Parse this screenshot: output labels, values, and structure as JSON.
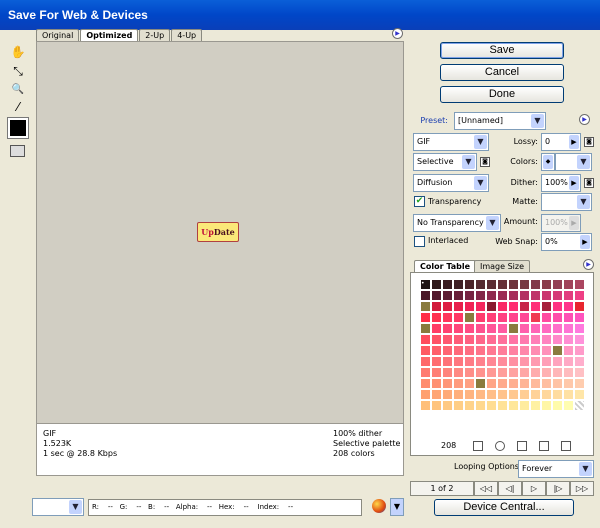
{
  "window": {
    "title": "Save For Web & Devices"
  },
  "tools": [
    {
      "name": "hand-tool-icon",
      "glyph": "✋"
    },
    {
      "name": "slice-select-tool-icon",
      "glyph": "⤡"
    },
    {
      "name": "zoom-tool-icon",
      "glyph": "🔍"
    },
    {
      "name": "eyedropper-tool-icon",
      "glyph": "⁄"
    }
  ],
  "tabs": [
    "Original",
    "Optimized",
    "2-Up",
    "4-Up"
  ],
  "preview": {
    "logo_text_up": "Up",
    "logo_text_date": "Date"
  },
  "info": {
    "format": "GIF",
    "size": "1.523K",
    "time": "1 sec @ 28.8 Kbps",
    "dither": "100% dither",
    "palette": "Selective palette",
    "colors": "208 colors"
  },
  "buttons": {
    "save": "Save",
    "cancel": "Cancel",
    "done": "Done",
    "device_central": "Device Central..."
  },
  "settings": {
    "preset_label": "Preset:",
    "preset_value": "[Unnamed]",
    "format": "GIF",
    "lossy_label": "Lossy:",
    "lossy_value": "0",
    "reduction": "Selective",
    "colors_label": "Colors:",
    "colors_value": "",
    "dither_algo": "Diffusion",
    "dither_label": "Dither:",
    "dither_value": "100%",
    "transparency_label": "Transparency",
    "matte_label": "Matte:",
    "trans_dither": "No Transparency ...",
    "amount_label": "Amount:",
    "amount_value": "100%",
    "interlaced_label": "Interlaced",
    "websnap_label": "Web Snap:",
    "websnap_value": "0%"
  },
  "color_table": {
    "tab_color": "Color Table",
    "tab_image_size": "Image Size",
    "count": "208",
    "swatches": [
      "#1d1313",
      "#2f181a",
      "#3a1c20",
      "#3f1f24",
      "#4a2227",
      "#552a30",
      "#5b2c33",
      "#652f37",
      "#6e323b",
      "#783843",
      "#82394a",
      "#8b3d4c",
      "#943f55",
      "#a0425a",
      "#ab4560",
      "#4b1727",
      "#53192d",
      "#5e1c33",
      "#6a1f39",
      "#772241",
      "#832547",
      "#8f284e",
      "#9b2b55",
      "#a72d5b",
      "#b33062",
      "#bf3369",
      "#cb3670",
      "#d63977",
      "#e23c7e",
      "#ee3f85",
      "#8a7b3e",
      "#d21a3b",
      "#de1d43",
      "#e8204c",
      "#f02355",
      "#f5265e",
      "#8b1a30",
      "#fa2a67",
      "#ff2d70",
      "#c82447",
      "#ff3079",
      "#a71f3b",
      "#ff3382",
      "#ff368b",
      "#e8262f",
      "#ff2e46",
      "#ff3150",
      "#ff355a",
      "#ff3864",
      "#8a7b3e",
      "#ff3c6e",
      "#ff3f78",
      "#ff4282",
      "#ff458c",
      "#ff4896",
      "#f03a52",
      "#ff4ba0",
      "#ff4eaa",
      "#ff51b4",
      "#ff54be",
      "#8a7b3e",
      "#ff3d66",
      "#ff4270",
      "#ff477a",
      "#ff4c84",
      "#ff518e",
      "#ff5698",
      "#ff5ba2",
      "#8a7b3e",
      "#ff60ac",
      "#ff65b6",
      "#ff6ac0",
      "#ff6fca",
      "#ff74d4",
      "#ff79de",
      "#ff4d5d",
      "#ff5266",
      "#ff576f",
      "#ff5c78",
      "#ff6181",
      "#ff668a",
      "#ff6b93",
      "#ff709c",
      "#ff75a5",
      "#ff7aae",
      "#ff7fb7",
      "#ff84c0",
      "#ff89c9",
      "#ff8ed2",
      "#ff93db",
      "#ff5a62",
      "#ff5f6a",
      "#ff6472",
      "#ff697a",
      "#ff6e82",
      "#ff738a",
      "#ff7892",
      "#ff7d9a",
      "#ff82a2",
      "#ff87aa",
      "#ff8cb2",
      "#ff91ba",
      "#8a7b3e",
      "#ff96c2",
      "#ff9bca",
      "#ff686a",
      "#ff6d71",
      "#ff7278",
      "#ff777f",
      "#ff7c86",
      "#ff818d",
      "#ff8694",
      "#ff8b9b",
      "#ff90a2",
      "#ff95a9",
      "#ff9ab0",
      "#ff9fb7",
      "#ffa4be",
      "#ffa9c5",
      "#ffaecc",
      "#ff7a70",
      "#ff7f76",
      "#ff847c",
      "#ff8982",
      "#ff8e88",
      "#ff938e",
      "#ff9894",
      "#ff9d9a",
      "#ffa2a0",
      "#ffa7a6",
      "#ffacac",
      "#ffb1b2",
      "#ffb6b8",
      "#ffbbbe",
      "#ffc0c4",
      "#ff8c6e",
      "#ff9173",
      "#ff9678",
      "#ff9b7d",
      "#ffa082",
      "#8a7b3e",
      "#ffa587",
      "#ffaa8c",
      "#ffaf91",
      "#ffb496",
      "#ffb99b",
      "#ffbea0",
      "#ffc3a5",
      "#ffc8aa",
      "#ffcdaf",
      "#ffa070",
      "#ffa574",
      "#ffaa78",
      "#ffaf7c",
      "#ffb480",
      "#ffb984",
      "#ffbe88",
      "#ffc38c",
      "#ffc890",
      "#ffcd94",
      "#ffd298",
      "#ffd79c",
      "#ffdca0",
      "#ffe1a4",
      "#ffe6a8",
      "#ffbf7a",
      "#ffc47e",
      "#ffc982",
      "#ffce86",
      "#ffd38a",
      "#ffd88e",
      "#ffdd92",
      "#ffe296",
      "#ffe79a",
      "#ffec9e",
      "#fff1a2",
      "#fff6a6",
      "#fffbaa",
      "#fffdb0",
      "#ffffff"
    ]
  },
  "looping": {
    "label": "Looping Options:",
    "value": "Forever"
  },
  "animation": {
    "frame": "1 of 2"
  },
  "status": {
    "readout": "R:    --   G:    --   B:    --   Alpha:    --   Hex:    --    Index:    --"
  }
}
